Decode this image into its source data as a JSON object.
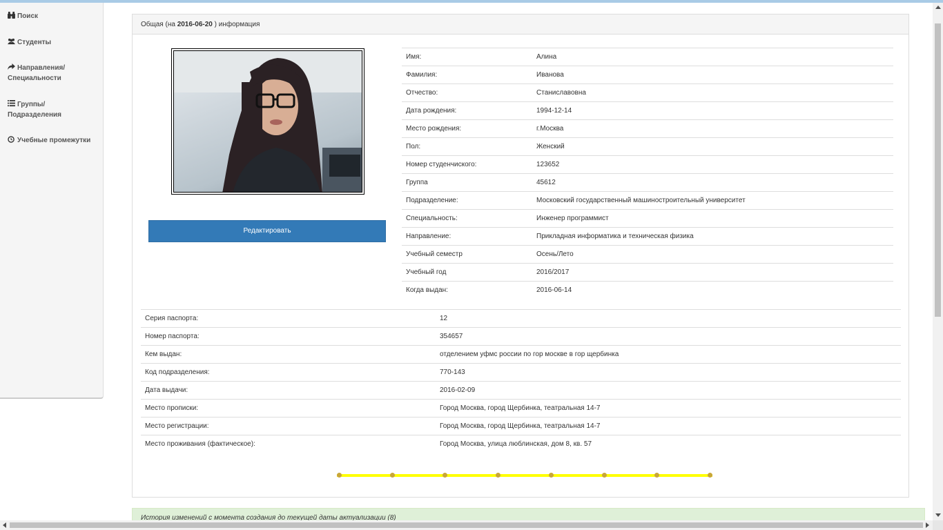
{
  "nav": {
    "search": "Поиск",
    "students": "Студенты",
    "directions_line1": "Направления/",
    "directions_line2": "Специальности",
    "groups_line1": "Группы/",
    "groups_line2": "Подразделения",
    "periods": "Учебные промежутки"
  },
  "panel": {
    "title_prefix": "Общая (на",
    "title_date": "2016-06-20",
    "title_suffix": ") информация"
  },
  "edit_button": "Редактировать",
  "info_rows": [
    {
      "label": "Имя:",
      "value": "Алина"
    },
    {
      "label": "Фамилия:",
      "value": "Иванова"
    },
    {
      "label": "Отчество:",
      "value": "Станиславовна"
    },
    {
      "label": "Дата рождения:",
      "value": "1994-12-14"
    },
    {
      "label": "Место рождения:",
      "value": "г.Москва"
    },
    {
      "label": "Пол:",
      "value": "Женский"
    },
    {
      "label": "Номер студенчиского:",
      "value": "123652"
    },
    {
      "label": "Группа",
      "value": "45612"
    },
    {
      "label": "Подразделение:",
      "value": "Московский государственный машиностроительный университет"
    },
    {
      "label": "Специальность:",
      "value": "Инженер программист"
    },
    {
      "label": "Направление:",
      "value": "Прикладная информатика и техническая физика"
    },
    {
      "label": "Учебный семестр",
      "value": "Осень/Лето"
    },
    {
      "label": "Учебный год",
      "value": "2016/2017"
    },
    {
      "label": "Когда выдан:",
      "value": "2016-06-14"
    }
  ],
  "passport_rows": [
    {
      "label": "Серия паспорта:",
      "value": "12"
    },
    {
      "label": "Номер паспорта:",
      "value": "354657"
    },
    {
      "label": "Кем выдан:",
      "value": "отделением уфмс россии по гор москве в гор щербинка"
    },
    {
      "label": "Код подразделения:",
      "value": "770-143"
    },
    {
      "label": "Дата выдачи:",
      "value": "2016-02-09"
    },
    {
      "label": "Место прописки:",
      "value": "Город Москва, город Щербинка, театральная 14-7"
    },
    {
      "label": "Место регистрации:",
      "value": "Город Москва, город Щербинка, театральная 14-7"
    },
    {
      "label": "Место проживания (фактическое):",
      "value": "Город Москва, улица люблинская, дом 8, кв. 57"
    }
  ],
  "timeline": {
    "points": 8,
    "line_color": "#ffff00",
    "dot_color": "#c8a63a"
  },
  "history": "История изменений с момента создания до текущей даты актуализации (8)",
  "colors": {
    "primary": "#337ab7",
    "topbar": "#a9cbe6",
    "history_bg": "#dff0d8"
  }
}
